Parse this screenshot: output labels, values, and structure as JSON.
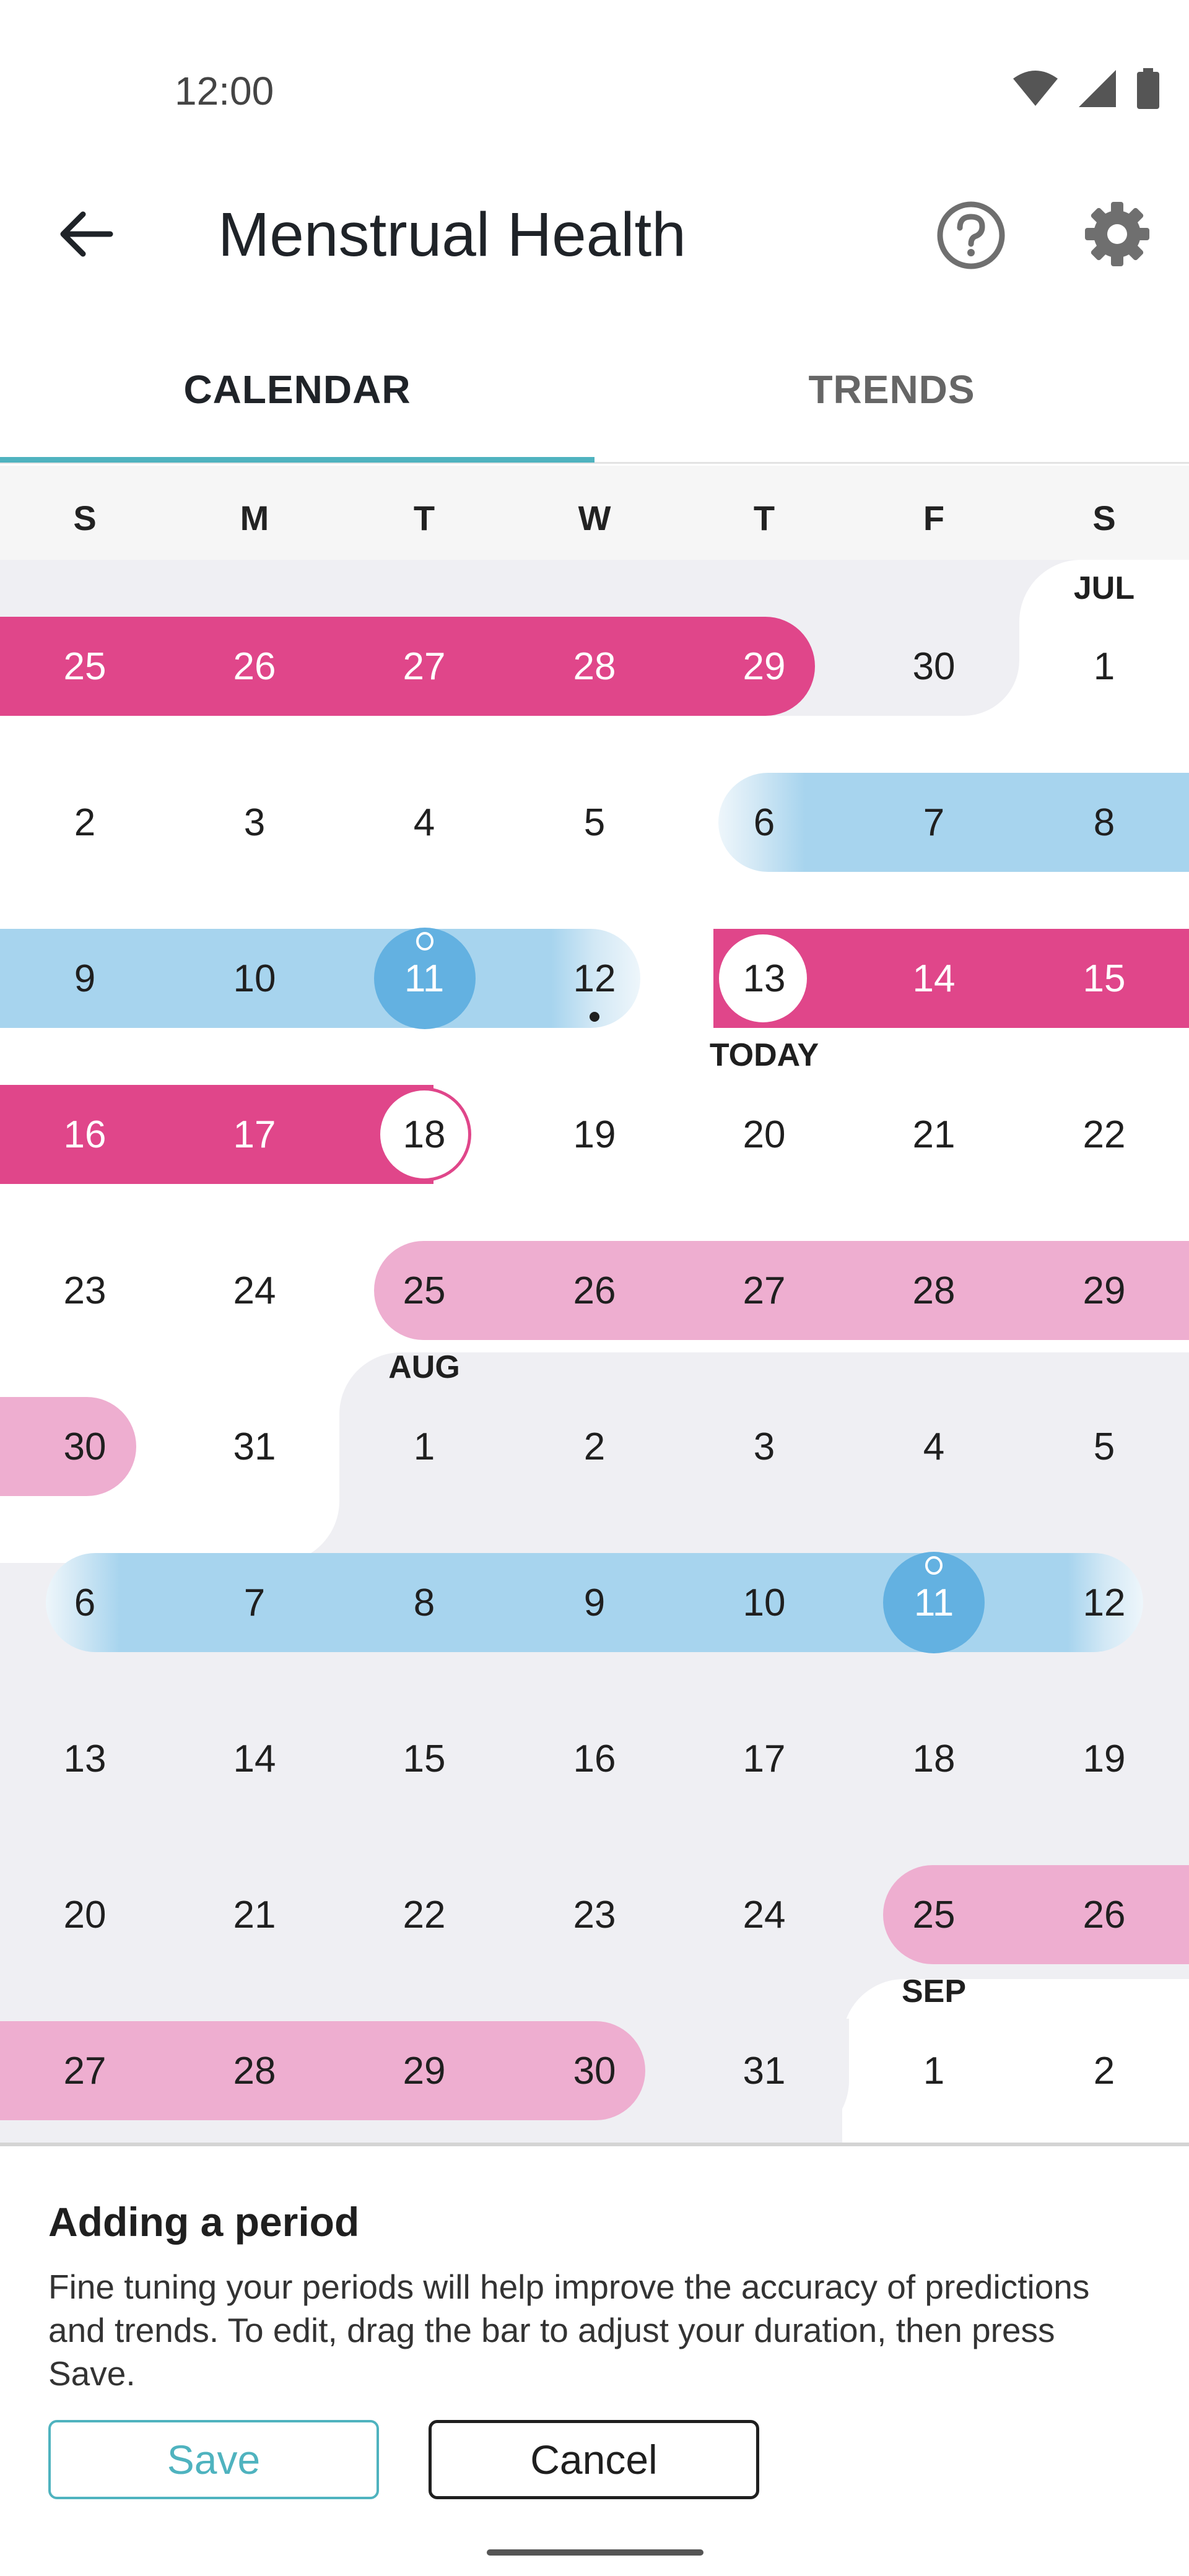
{
  "status": {
    "time": "12:00",
    "icons": [
      "wifi-icon",
      "signal-icon",
      "battery-icon"
    ]
  },
  "appbar": {
    "title": "Menstrual Health",
    "icons": [
      "back-arrow-icon",
      "help-icon",
      "gear-icon"
    ]
  },
  "tabs": [
    {
      "label": "CALENDAR",
      "selected": true
    },
    {
      "label": "TRENDS",
      "selected": false
    }
  ],
  "weekdays": [
    "S",
    "M",
    "T",
    "W",
    "T",
    "F",
    "S"
  ],
  "colors": {
    "period": "#e0468a",
    "predicted_period": "#eeaed0",
    "fertile": "#a7d4ee",
    "ovulation": "#63b1e1",
    "accent": "#4fb3bf",
    "future_bg": "#efeff3"
  },
  "calendar": {
    "weeks": [
      [
        "25",
        "26",
        "27",
        "28",
        "29",
        "30",
        "1"
      ],
      [
        "2",
        "3",
        "4",
        "5",
        "6",
        "7",
        "8"
      ],
      [
        "9",
        "10",
        "11",
        "12",
        "13",
        "14",
        "15"
      ],
      [
        "16",
        "17",
        "18",
        "19",
        "20",
        "21",
        "22"
      ],
      [
        "23",
        "24",
        "25",
        "26",
        "27",
        "28",
        "29"
      ],
      [
        "30",
        "31",
        "1",
        "2",
        "3",
        "4",
        "5"
      ],
      [
        "6",
        "7",
        "8",
        "9",
        "10",
        "11",
        "12"
      ],
      [
        "13",
        "14",
        "15",
        "16",
        "17",
        "18",
        "19"
      ],
      [
        "20",
        "21",
        "22",
        "23",
        "24",
        "25",
        "26"
      ],
      [
        "27",
        "28",
        "29",
        "30",
        "31",
        "1",
        "2"
      ]
    ],
    "month_labels": {
      "jul": "JUL",
      "aug": "AUG",
      "sep": "SEP"
    },
    "today_label": "TODAY"
  },
  "panel": {
    "title": "Adding a period",
    "body": "Fine tuning your periods will help improve the accuracy of predictions and trends. To edit, drag the bar to adjust your duration, then press Save.",
    "save_label": "Save",
    "cancel_label": "Cancel"
  }
}
